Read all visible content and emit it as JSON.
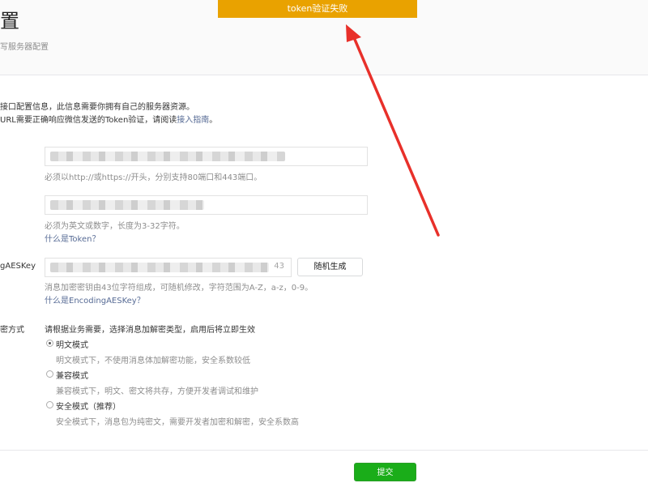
{
  "header": {
    "title": "置",
    "subtitle": "写服务器配置"
  },
  "toast": {
    "message": "token验证失败"
  },
  "intro": {
    "line1": "接口配置信息，此信息需要你拥有自己的服务器资源。",
    "line2_prefix": "URL需要正确响应微信发送的Token验证，请阅读",
    "line2_link": "接入指南",
    "line2_suffix": "。"
  },
  "url_field": {
    "hint": "必须以http://或https://开头，分别支持80端口和443端口。"
  },
  "token_field": {
    "hint": "必须为英文或数字，长度为3-32字符。",
    "help_link": "什么是Token？"
  },
  "aes_field": {
    "label": "gAESKey",
    "value_tail": "43",
    "random_button": "随机生成",
    "hint": "消息加密密钥由43位字符组成，可随机修改，字符范围为A-Z，a-z，0-9。",
    "help_link": "什么是EncodingAESKey？"
  },
  "encryption": {
    "label": "密方式",
    "prompt": "请根据业务需要，选择消息加解密类型，启用后将立即生效",
    "options": [
      {
        "label": "明文模式",
        "desc": "明文模式下，不使用消息体加解密功能，安全系数较低",
        "checked": true
      },
      {
        "label": "兼容模式",
        "desc": "兼容模式下，明文、密文将共存，方便开发者调试和维护",
        "checked": false
      },
      {
        "label": "安全模式（推荐）",
        "desc": "安全模式下，消息包为纯密文，需要开发者加密和解密，安全系数高",
        "checked": false
      }
    ]
  },
  "footer": {
    "submit_label": "提交"
  },
  "colors": {
    "toast": "#e9a200",
    "submit": "#1aad19",
    "link": "#576b95",
    "arrow": "#e8302a"
  }
}
